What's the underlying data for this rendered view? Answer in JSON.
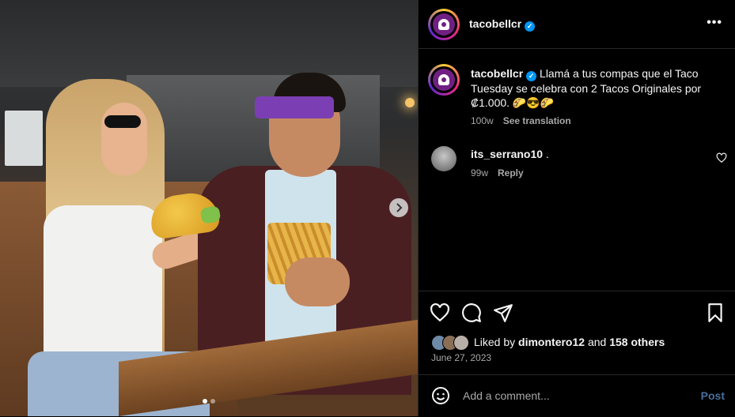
{
  "post": {
    "author": "tacobellcr",
    "verified_mark": "✓",
    "more_icon": "•••",
    "caption_text": "Llamá a tus compas que el Taco Tuesday se celebra con 2 Tacos Originales por ₡1.000. 🌮😎🌮",
    "caption_age": "100w",
    "see_translation": "See translation"
  },
  "comments": [
    {
      "user": "its_serrano10",
      "text": ".",
      "age": "99w",
      "reply_label": "Reply"
    }
  ],
  "likes": {
    "liked_by_prefix": "Liked by",
    "liked_by_user": "dimontero12",
    "and": "and",
    "others": "158 others"
  },
  "date": "June 27, 2023",
  "comment_input": {
    "placeholder": "Add a comment...",
    "post_label": "Post"
  },
  "carousel": {
    "slides": 2,
    "active": 1
  },
  "colors": {
    "accent": "#0095f6",
    "brand": "#702082",
    "muted": "#a8a8a8",
    "post_disabled": "#4a6f9a"
  },
  "icons": [
    "more-icon",
    "verified-icon",
    "heart-icon",
    "comment-icon",
    "share-icon",
    "save-icon",
    "emoji-icon",
    "chevron-right-icon"
  ]
}
